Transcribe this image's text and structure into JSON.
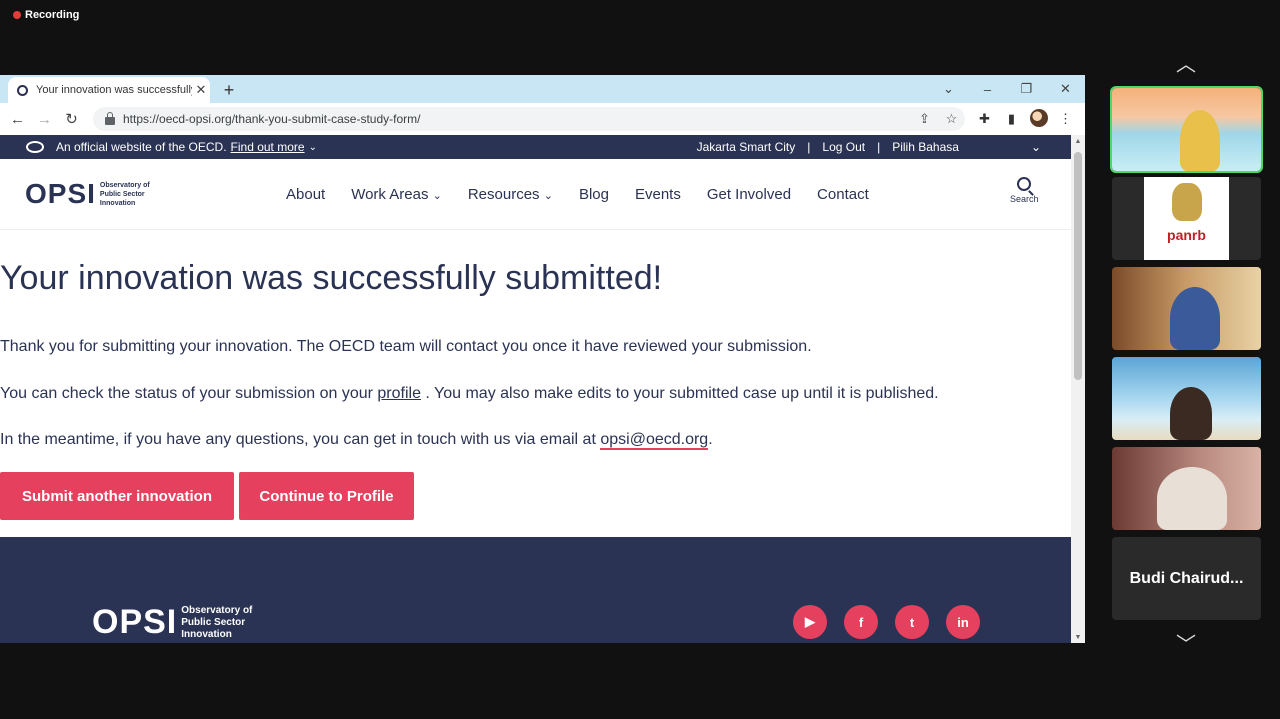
{
  "recording": {
    "label": "Recording"
  },
  "browser": {
    "tab_title": "Your innovation was successfully submitted",
    "url": "https://oecd-opsi.org/thank-you-submit-case-study-form/"
  },
  "site": {
    "official_text": "An official website of the OECD.",
    "find_out_more": "Find out more",
    "user_org": "Jakarta Smart City",
    "separator": "|",
    "logout": "Log Out",
    "language": "Pilih Bahasa",
    "logo_word": "OPSI",
    "logo_sub": "Observatory of Public Sector Innovation",
    "nav": {
      "about": "About",
      "work_areas": "Work Areas",
      "resources": "Resources",
      "blog": "Blog",
      "events": "Events",
      "get_involved": "Get Involved",
      "contact": "Contact"
    },
    "search_label": "Search"
  },
  "content": {
    "heading": "Your innovation was successfully submitted!",
    "p1": "Thank you for submitting your innovation. The OECD team will contact you once it have reviewed your submission.",
    "p2_before": "You can check the status of your submission on your ",
    "p2_link": "profile",
    "p2_after": " . You may also make edits to your submitted case up until it is published.",
    "p3_before": "In the meantime, if you have any questions, you can get in touch with us via email at ",
    "p3_email": "opsi@oecd.org",
    "p3_after": ".",
    "btn_submit_another": "Submit another innovation",
    "btn_continue_profile": "Continue to Profile"
  },
  "footer": {
    "logo_word": "OPSI",
    "logo_sub": "Observatory of Public Sector Innovation",
    "social": {
      "youtube": "▶",
      "facebook": "f",
      "twitter": "t",
      "linkedin": "in"
    }
  },
  "participants": {
    "panrb_label": "panrb",
    "name_tile": "Budi Chairud..."
  },
  "colors": {
    "accent": "#e6405f",
    "navy": "#2b3354"
  }
}
